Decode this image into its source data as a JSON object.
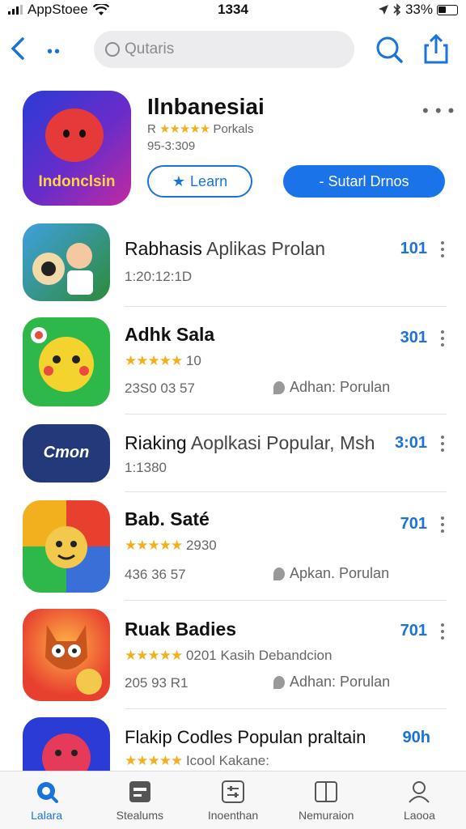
{
  "status_bar": {
    "carrier": "AppStoee",
    "time": "1334",
    "battery": "33%"
  },
  "nav": {
    "search_placeholder": "Qutaris"
  },
  "featured": {
    "title": "Ilnbanesiai",
    "brand": "Indonclsin",
    "rating_prefix": "R",
    "stars": "★★★★★",
    "rating_label": "Porkals",
    "size": "95-3:309",
    "learn_label": "Learn",
    "primary_label": "- Sutarl Drnos"
  },
  "list": [
    {
      "title": "Rabhasis",
      "title_rest": "Aplikas Prolan",
      "title_bold": false,
      "sub": "1:20:12:1D",
      "count": "101"
    },
    {
      "title": "Adhk Sala",
      "title_rest": "",
      "title_bold": true,
      "stars": "★★★★★",
      "sub": "10",
      "meta": "23S0 03 57",
      "category": "Adhan: Porulan",
      "count": "301"
    },
    {
      "title": "Riaking",
      "title_rest": "Aoplkasi Popular, Msh",
      "title_bold": false,
      "sub": "1:1380",
      "icon_text": "Cmon",
      "count": "3:01"
    },
    {
      "title": "Bab. Saté",
      "title_rest": "",
      "title_bold": true,
      "stars": "★★★★★",
      "sub": "2930",
      "meta": "436 36 57",
      "category": "Apkan. Porulan",
      "count": "701"
    },
    {
      "title": "Ruak Badies",
      "title_rest": "",
      "title_bold": true,
      "stars": "★★★★★",
      "sub": "0201 Kasih Debandcion",
      "meta": "205 93 R1",
      "category": "Adhan: Porulan",
      "count": "701"
    },
    {
      "title": "Flakip Codles Populan praltain",
      "title_rest": "",
      "title_bold": false,
      "stars": "★★★★★",
      "sub": "Icool Kakane:",
      "count": "90h"
    }
  ],
  "tabs": [
    {
      "label": "Lalara",
      "icon": "search-icon",
      "active": true
    },
    {
      "label": "Stealums",
      "icon": "card-icon",
      "active": false
    },
    {
      "label": "Inoenthan",
      "icon": "sliders-icon",
      "active": false
    },
    {
      "label": "Nemuraion",
      "icon": "book-icon",
      "active": false
    },
    {
      "label": "Laooa",
      "icon": "person-icon",
      "active": false
    }
  ],
  "colors": {
    "accent": "#1a73d9",
    "star": "#f2b01e"
  }
}
